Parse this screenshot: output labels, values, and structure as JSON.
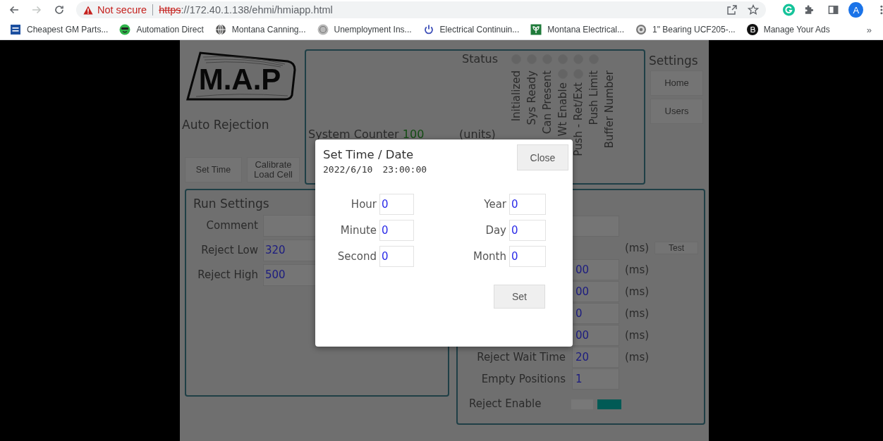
{
  "browser": {
    "nav": [
      {
        "kind": "back",
        "disabled": false
      },
      {
        "kind": "forward",
        "disabled": true
      },
      {
        "kind": "reload",
        "disabled": false
      }
    ],
    "security": "Not secure",
    "url_scheme": "https",
    "url_rest": "://172.40.1.138/ehmi/hmiapp.html",
    "profile_initial": "A"
  },
  "bookmarks": {
    "items": [
      {
        "label": "Cheapest GM Parts...",
        "kind": "square"
      },
      {
        "label": "Automation Direct",
        "kind": "smiley"
      },
      {
        "label": "Montana Canning...",
        "kind": "globe"
      },
      {
        "label": "Unemployment Ins...",
        "kind": "seal"
      },
      {
        "label": "Electrical Continuin...",
        "kind": "power"
      },
      {
        "label": "Montana Electrical...",
        "kind": "leaf"
      },
      {
        "label": "1\" Bearing UCF205-...",
        "kind": "ring"
      },
      {
        "label": "Manage Your Ads",
        "kind": "dark-circle"
      }
    ],
    "overflow": "»"
  },
  "app": {
    "logo_text": "M.A.P",
    "subtitle": "Auto Rejection",
    "buttons": [
      "Set Time",
      "Calibrate Load Cell"
    ],
    "counter": {
      "label": "System Counter",
      "value": "100",
      "unit": "(units)"
    },
    "status": {
      "title": "Status",
      "top_lamps": [
        {
          "on": false
        },
        {
          "on": false
        },
        {
          "on": false
        },
        {
          "on": false
        },
        {
          "on": false
        },
        {
          "on": false
        }
      ],
      "columns": [
        {
          "kind": "plain",
          "label": "Initialized"
        },
        {
          "kind": "plain",
          "label": "Sys Ready"
        },
        {
          "kind": "plain",
          "label": "Can Present"
        },
        {
          "kind": "lamp",
          "label": "Wt Enable",
          "on": false
        },
        {
          "kind": "lamp",
          "label": "Push - Ret/Ext",
          "on": false
        },
        {
          "kind": "plain",
          "label": "Push Limit"
        },
        {
          "kind": "plain",
          "label": "Buffer Number"
        }
      ]
    },
    "settings": {
      "title": "Settings",
      "buttons": [
        "Home",
        "Users"
      ]
    },
    "run_settings": {
      "title": "Run Settings",
      "rows": [
        {
          "label": "Comment"
        },
        {
          "label": "Reject Low",
          "value": "320"
        },
        {
          "label": "Reject High",
          "value": "500"
        }
      ]
    },
    "right_panel": {
      "rows": [
        {
          "kind": "field"
        },
        {
          "kind": "unit-only",
          "unit": "(ms)",
          "button": "Test"
        },
        {
          "kind": "field",
          "value": "00",
          "unit": "(ms)"
        },
        {
          "kind": "field",
          "value": "00",
          "unit": "(ms)"
        },
        {
          "kind": "field",
          "value": "0",
          "unit": "(ms)"
        },
        {
          "kind": "field",
          "value": "00",
          "unit": "(ms)"
        },
        {
          "kind": "field",
          "label": "Reject Wait Time",
          "value": "20",
          "unit": "(ms)"
        },
        {
          "kind": "field",
          "label": "Empty Positions",
          "value": "1"
        },
        {
          "kind": "toggle",
          "label": "Reject Enable",
          "on": true
        }
      ]
    }
  },
  "dialog": {
    "title": "Set Time / Date",
    "date": "2022/6/10",
    "time": "23:00:00",
    "close": "Close",
    "fields": [
      {
        "label": "Hour",
        "value": "0"
      },
      {
        "label": "Year",
        "value": "0"
      },
      {
        "label": "Minute",
        "value": "0"
      },
      {
        "label": "Day",
        "value": "0"
      },
      {
        "label": "Second",
        "value": "0"
      },
      {
        "label": "Month",
        "value": "0"
      }
    ],
    "submit": "Set"
  }
}
